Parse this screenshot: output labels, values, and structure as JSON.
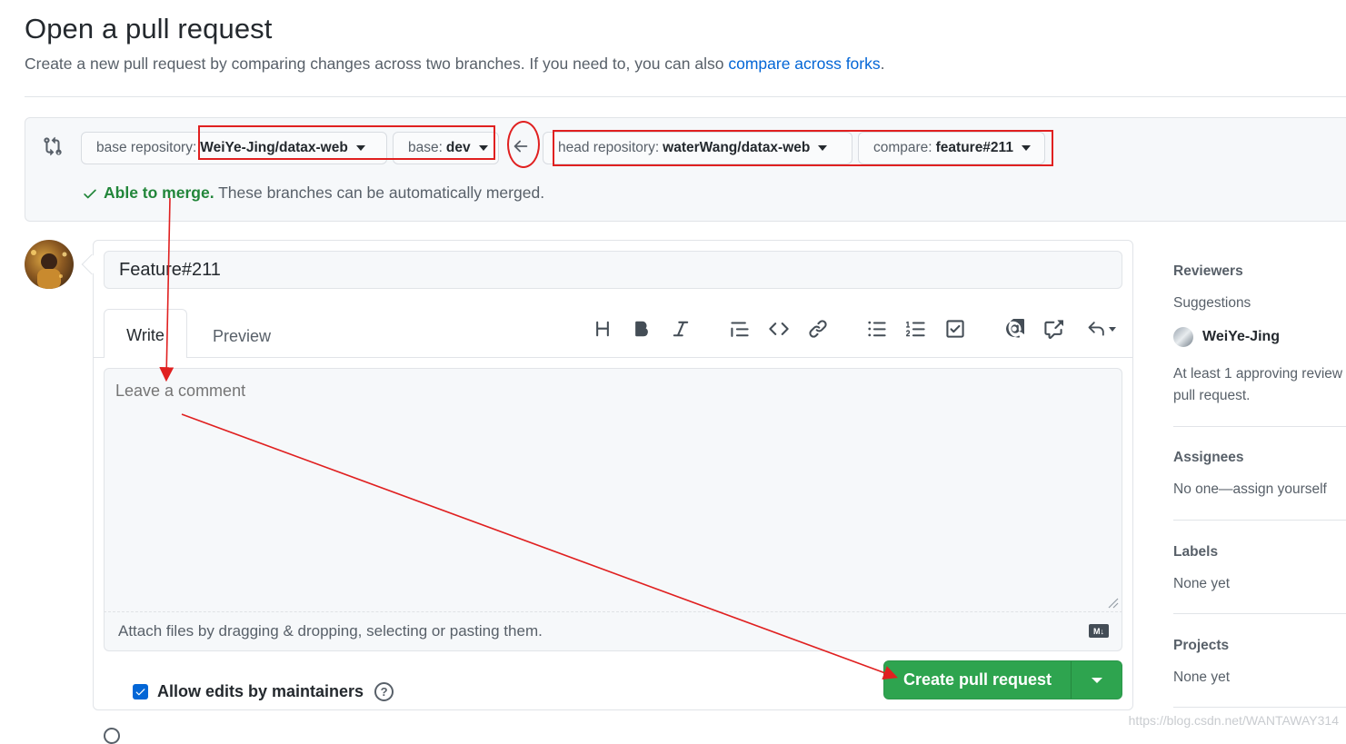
{
  "header": {
    "title": "Open a pull request",
    "subtitle_text": "Create a new pull request by comparing changes across two branches. If you need to, you can also ",
    "subtitle_link": "compare across forks",
    "subtitle_end": "."
  },
  "compare": {
    "base_repo_label": "base repository: ",
    "base_repo_value": "WeiYe-Jing/datax-web",
    "base_label": "base: ",
    "base_value": "dev",
    "head_repo_label": "head repository: ",
    "head_repo_value": "waterWang/datax-web",
    "compare_label": "compare: ",
    "compare_value": "feature#211",
    "merge_ok": "Able to merge.",
    "merge_text": " These branches can be automatically merged."
  },
  "composer": {
    "title_value": "Feature#211",
    "tab_write": "Write",
    "tab_preview": "Preview",
    "comment_placeholder": "Leave a comment",
    "attach_text": "Attach files by dragging & dropping, selecting or pasting them.",
    "md_badge": "M↓",
    "allow_edits_label": "Allow edits by maintainers",
    "help_glyph": "?",
    "create_button": "Create pull request",
    "allow_edits_checked": true
  },
  "toolbar": {
    "icons": [
      "heading-icon",
      "bold-icon",
      "italic-icon",
      "quote-icon",
      "code-icon",
      "link-icon",
      "bulleted-list-icon",
      "numbered-list-icon",
      "task-list-icon",
      "mention-icon",
      "cross-reference-icon",
      "reply-icon"
    ]
  },
  "sidebar": {
    "reviewers_heading": "Reviewers",
    "suggestions_label": "Suggestions",
    "suggested_reviewer": "WeiYe-Jing",
    "reviewers_note_line1": "At least 1 approving review",
    "reviewers_note_line2": "pull request.",
    "assignees_heading": "Assignees",
    "assignees_value": "No one—assign yourself",
    "labels_heading": "Labels",
    "labels_value": "None yet",
    "projects_heading": "Projects",
    "projects_value": "None yet"
  },
  "watermark": "https://blog.csdn.net/WANTAWAY314",
  "colors": {
    "accent_link": "#0366d6",
    "success_green": "#2ea44f",
    "merge_green": "#22863a",
    "annotation_red": "#e02020"
  }
}
